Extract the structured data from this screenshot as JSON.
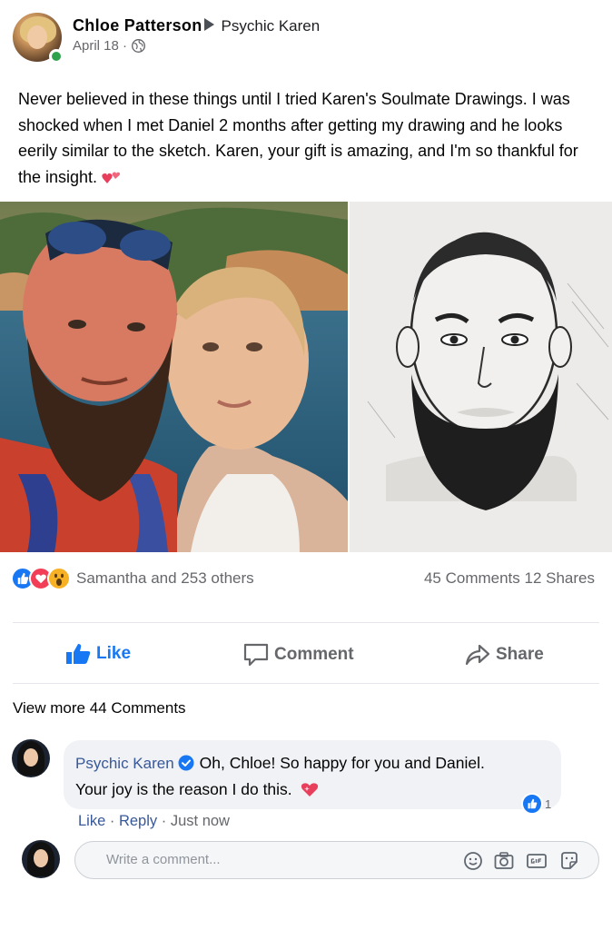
{
  "post": {
    "author": "Chloe Patterson",
    "target_page": "Psychic Karen",
    "date": "April 18 ·",
    "text": "Never believed in these things until I tried Karen's Soulmate Drawings. I was shocked when I met Daniel 2 months after getting my drawing and he looks eerily similar to the sketch. Karen, your gift is amazing, and I'm so thankful for the insight."
  },
  "engagement": {
    "reactions_text": "Samantha and 253 others",
    "comments_shares": "45 Comments 12 Shares"
  },
  "actions": {
    "like": "Like",
    "comment": "Comment",
    "share": "Share"
  },
  "view_more": "View more 44 Comments",
  "comment": {
    "author": "Psychic Karen",
    "text_line1": "Oh, Chloe! So happy for you and Daniel.",
    "text_line2": "Your joy is the reason I do this.",
    "reaction_count": "1",
    "like": "Like",
    "reply": "Reply",
    "time": "Just now"
  },
  "composer": {
    "placeholder": "Write a comment..."
  },
  "colors": {
    "brand_blue": "#1877f2",
    "link_blue": "#385898",
    "muted_text": "#65676b",
    "online_green": "#31a24c"
  },
  "icons": [
    "online-dot",
    "globe-icon",
    "sparkling-heart-emoji",
    "like-reaction-icon",
    "love-reaction-icon",
    "wow-reaction-icon",
    "thumbs-up-icon",
    "comment-icon",
    "share-icon",
    "verified-icon",
    "emoji-icon",
    "camera-icon",
    "gif-icon",
    "sticker-icon"
  ]
}
